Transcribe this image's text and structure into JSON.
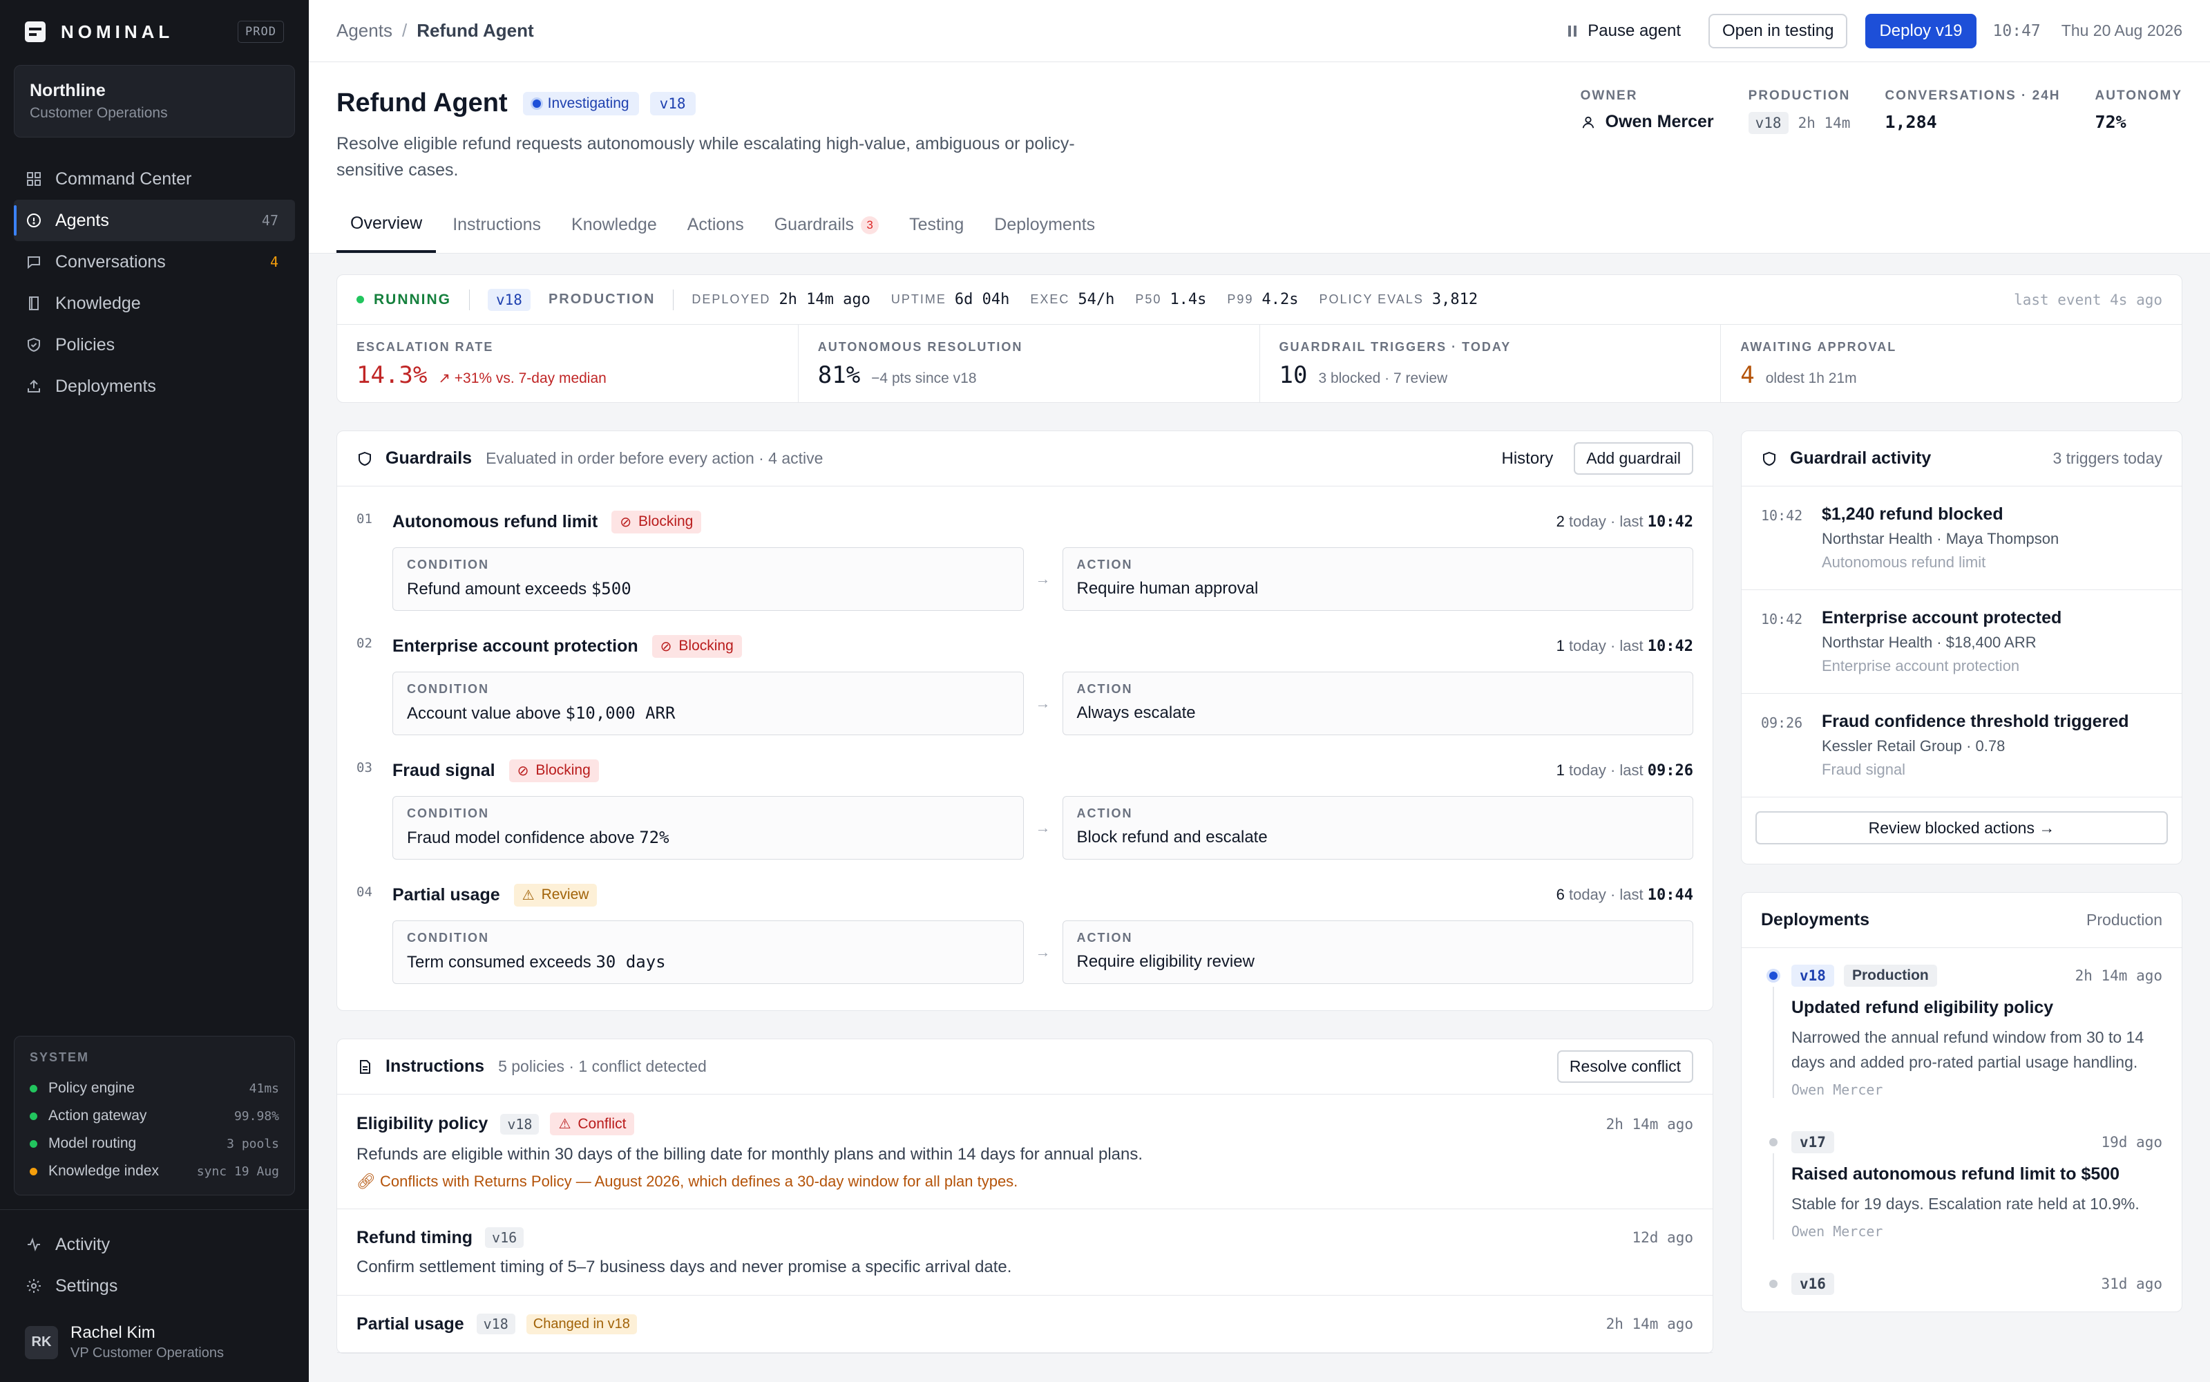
{
  "brand": {
    "name": "NOMINAL",
    "env": "PROD"
  },
  "org": {
    "name": "Northline",
    "sub": "Customer Operations"
  },
  "nav": [
    {
      "label": "Command Center",
      "count": ""
    },
    {
      "label": "Agents",
      "count": "47"
    },
    {
      "label": "Conversations",
      "count": "4"
    },
    {
      "label": "Knowledge",
      "count": ""
    },
    {
      "label": "Policies",
      "count": ""
    },
    {
      "label": "Deployments",
      "count": ""
    }
  ],
  "system": {
    "title": "SYSTEM",
    "rows": [
      {
        "label": "Policy engine",
        "value": "41ms"
      },
      {
        "label": "Action gateway",
        "value": "99.98%"
      },
      {
        "label": "Model routing",
        "value": "3 pools"
      },
      {
        "label": "Knowledge index",
        "value": "sync 19 Aug"
      }
    ]
  },
  "bottom_nav": {
    "activity": "Activity",
    "settings": "Settings"
  },
  "user": {
    "initials": "RK",
    "name": "Rachel Kim",
    "role": "VP Customer Operations"
  },
  "topbar": {
    "crumb_root": "Agents",
    "crumb_sep": "/",
    "crumb_current": "Refund Agent",
    "pause": "Pause agent",
    "open_testing": "Open in testing",
    "deploy": "Deploy v19",
    "time": "10:47",
    "date": "Thu 20 Aug 2026"
  },
  "agent": {
    "title": "Refund Agent",
    "status": "Investigating",
    "version": "v18",
    "description": "Resolve eligible refund requests autonomously while escalating high-value, ambiguous or policy-sensitive cases."
  },
  "stats": {
    "owner_label": "OWNER",
    "owner": "Owen Mercer",
    "production_label": "PRODUCTION",
    "production_ver": "v18",
    "production_age": "2h 14m",
    "conv_label": "CONVERSATIONS · 24H",
    "conv": "1,284",
    "autonomy_label": "AUTONOMY",
    "autonomy": "72%"
  },
  "tabs": [
    {
      "label": "Overview"
    },
    {
      "label": "Instructions"
    },
    {
      "label": "Knowledge"
    },
    {
      "label": "Actions"
    },
    {
      "label": "Guardrails",
      "count": "3"
    },
    {
      "label": "Testing"
    },
    {
      "label": "Deployments"
    }
  ],
  "runbar": {
    "status": "RUNNING",
    "version": "v18",
    "env": "PRODUCTION",
    "deployed_k": "DEPLOYED",
    "deployed_v": "2h 14m ago",
    "uptime_k": "UPTIME",
    "uptime_v": "6d 04h",
    "exec_k": "EXEC",
    "exec_v": "54/h",
    "p50_k": "P50",
    "p50_v": "1.4s",
    "p99_k": "P99",
    "p99_v": "4.2s",
    "evals_k": "POLICY EVALS",
    "evals_v": "3,812",
    "last": "last event 4s ago"
  },
  "kpis": [
    {
      "label": "ESCALATION RATE",
      "value": "14.3%",
      "note": "↗ +31% vs. 7-day median"
    },
    {
      "label": "AUTONOMOUS RESOLUTION",
      "value": "81%",
      "note": "−4 pts since v18"
    },
    {
      "label": "GUARDRAIL TRIGGERS · TODAY",
      "value": "10",
      "note": "3 blocked · 7 review"
    },
    {
      "label": "AWAITING APPROVAL",
      "value": "4",
      "note": "oldest 1h 21m"
    }
  ],
  "guardrails": {
    "title": "Guardrails",
    "sub": "Evaluated in order before every action · 4 active",
    "history": "History",
    "add": "Add guardrail",
    "cond_label": "CONDITION",
    "action_label": "ACTION",
    "items": [
      {
        "num": "01",
        "name": "Autonomous refund limit",
        "badge": "Blocking",
        "count": "2",
        "today": "today",
        "last": "last",
        "last_time": "10:42",
        "cond_pre": "Refund amount exceeds ",
        "cond_code": "$500",
        "action": "Require human approval"
      },
      {
        "num": "02",
        "name": "Enterprise account protection",
        "badge": "Blocking",
        "count": "1",
        "today": "today",
        "last": "last",
        "last_time": "10:42",
        "cond_pre": "Account value above ",
        "cond_code": "$10,000 ARR",
        "action": "Always escalate"
      },
      {
        "num": "03",
        "name": "Fraud signal",
        "badge": "Blocking",
        "count": "1",
        "today": "today",
        "last": "last",
        "last_time": "09:26",
        "cond_pre": "Fraud model confidence above ",
        "cond_code": "72%",
        "action": "Block refund and escalate"
      },
      {
        "num": "04",
        "name": "Partial usage",
        "badge": "Review",
        "count": "6",
        "today": "today",
        "last": "last",
        "last_time": "10:44",
        "cond_pre": "Term consumed exceeds ",
        "cond_code": "30 days",
        "action": "Require eligibility review"
      }
    ]
  },
  "instructions": {
    "title": "Instructions",
    "sub": "5 policies · 1 conflict detected",
    "resolve": "Resolve conflict",
    "items": [
      {
        "name": "Eligibility policy",
        "ver": "v18",
        "badge": "Conflict",
        "time": "2h 14m ago",
        "text": "Refunds are eligible within 30 days of the billing date for monthly plans and within 14 days for annual plans.",
        "warn": "Conflicts with Returns Policy — August 2026, which defines a 30-day window for all plan types."
      },
      {
        "name": "Refund timing",
        "ver": "v16",
        "time": "12d ago",
        "text": "Confirm settlement timing of 5–7 business days and never promise a specific arrival date."
      },
      {
        "name": "Partial usage",
        "ver": "v18",
        "badge": "Changed in v18",
        "time": "2h 14m ago"
      }
    ]
  },
  "activity": {
    "title": "Guardrail activity",
    "sub": "3 triggers today",
    "review": "Review blocked actions",
    "items": [
      {
        "time": "10:42",
        "title": "$1,240 refund blocked",
        "sub": "Northstar Health · Maya Thompson",
        "rule": "Autonomous refund limit"
      },
      {
        "time": "10:42",
        "title": "Enterprise account protected",
        "sub": "Northstar Health · $18,400 ARR",
        "rule": "Enterprise account protection"
      },
      {
        "time": "09:26",
        "title": "Fraud confidence threshold triggered",
        "sub": "Kessler Retail Group · 0.78",
        "rule": "Fraud signal"
      }
    ]
  },
  "deployments": {
    "title": "Deployments",
    "sub": "Production",
    "items": [
      {
        "ver": "v18",
        "env": "Production",
        "time": "2h 14m ago",
        "title": "Updated refund eligibility policy",
        "text": "Narrowed the annual refund window from 30 to 14 days and added pro-rated partial usage handling.",
        "author": "Owen Mercer"
      },
      {
        "ver": "v17",
        "time": "19d ago",
        "title": "Raised autonomous refund limit to $500",
        "text": "Stable for 19 days. Escalation rate held at 10.9%.",
        "author": "Owen Mercer"
      },
      {
        "ver": "v16",
        "time": "31d ago"
      }
    ]
  },
  "colors": {
    "accent": "#1d4fd8",
    "danger": "#c02626",
    "warning": "#b45309",
    "success": "#15803d",
    "sidebar": "#15171c"
  }
}
